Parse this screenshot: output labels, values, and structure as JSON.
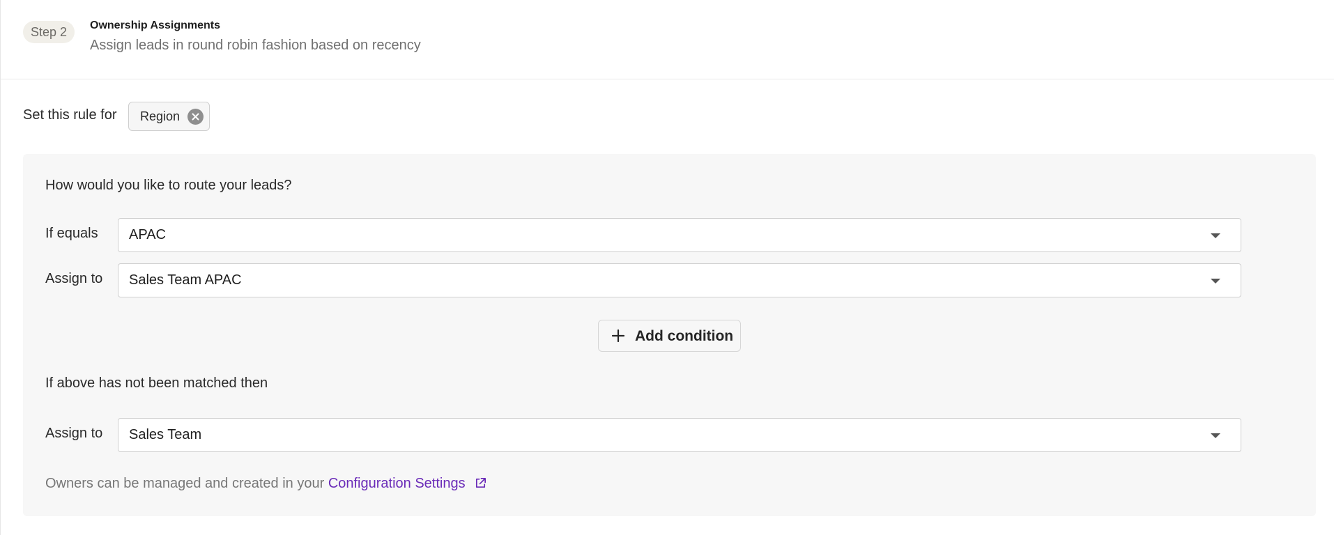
{
  "header": {
    "step_badge": "Step 2",
    "title": "Ownership Assignments",
    "subtitle": "Assign leads in round robin fashion based on recency"
  },
  "rule": {
    "label": "Set this rule for",
    "chip_label": "Region"
  },
  "routing": {
    "question": "How would you like to route your leads?",
    "conditions": [
      {
        "if_label": "If equals",
        "if_value": "APAC",
        "assign_label": "Assign to",
        "assign_value": "Sales Team APAC"
      }
    ],
    "add_condition_label": "Add condition",
    "fallback_text": "If above has not been matched then",
    "fallback_assign_label": "Assign to",
    "fallback_assign_value": "Sales Team"
  },
  "footer": {
    "text": "Owners can be managed and created in your",
    "link_label": "Configuration Settings"
  },
  "icons": {
    "chip_remove": "close-circle-icon",
    "select_caret": "chevron-down-icon",
    "add": "plus-icon",
    "link": "external-link-icon"
  },
  "colors": {
    "link": "#6a2bb8",
    "step_badge_bg": "#f1efe9",
    "panel_bg": "#f7f7f7"
  }
}
